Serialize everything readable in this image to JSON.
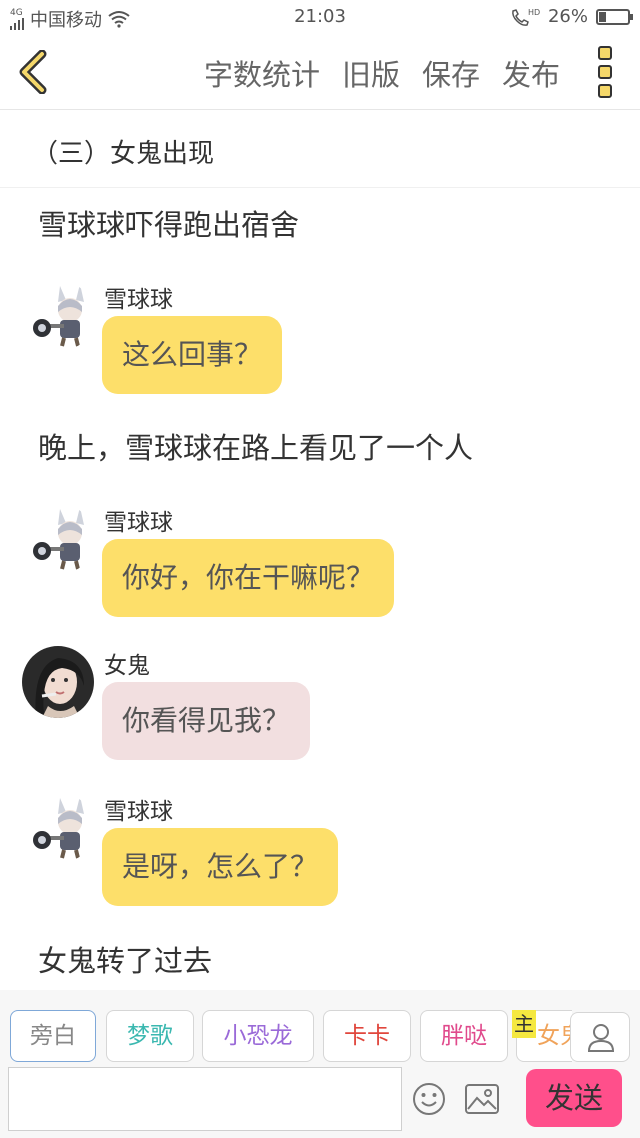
{
  "status": {
    "network": "4G",
    "carrier": "中国移动",
    "time": "21:03",
    "hd": "HD",
    "battery_percent": 26,
    "battery_text": "26%"
  },
  "toolbar": {
    "back_icon": "chevron-left-icon",
    "word_count": "字数统计",
    "old_version": "旧版",
    "save": "保存",
    "publish": "发布",
    "more_icon": "more-icon"
  },
  "chapter": {
    "title": "（三）女鬼出现"
  },
  "story": {
    "narration_1": "雪球球吓得跑出宿舍",
    "msg_1": {
      "sender": "雪球球",
      "text": "这么回事？"
    },
    "narration_2": "晚上，雪球球在路上看见了一个人",
    "msg_2": {
      "sender": "雪球球",
      "text": "你好，你在干嘛呢？"
    },
    "msg_3": {
      "sender": "女鬼",
      "text": "你看得见我？"
    },
    "msg_4": {
      "sender": "雪球球",
      "text": "是呀，怎么了？"
    },
    "narration_3": "女鬼转了过去"
  },
  "characters": [
    {
      "name": "旁白",
      "color": "#888888"
    },
    {
      "name": "梦歌",
      "color": "#3bb8b0"
    },
    {
      "name": "小恐龙",
      "color": "#9a6ad8"
    },
    {
      "name": "卡卡",
      "color": "#e0463c"
    },
    {
      "name": "胖哒",
      "color": "#e04a8c"
    },
    {
      "name": "女鬼",
      "color": "#f0a35a"
    }
  ],
  "host_tag": "主",
  "input": {
    "placeholder": "",
    "send_label": "发送"
  },
  "colors": {
    "accent_yellow": "#fddf6a",
    "send_pink": "#ff4f8b",
    "ghost_bubble": "#f2dfe0"
  }
}
